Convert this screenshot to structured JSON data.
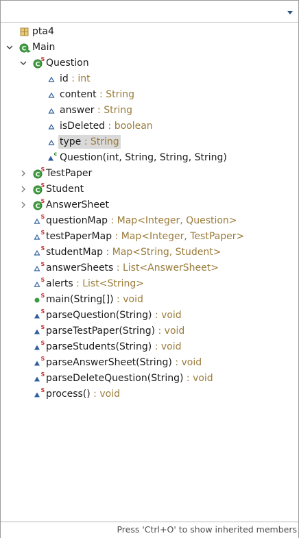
{
  "filter": {
    "value": "",
    "placeholder": ""
  },
  "status": "Press 'Ctrl+O' to show inherited members",
  "nodes": [
    {
      "level": 0,
      "twisty": "none",
      "icon": "package-icon",
      "name": "pta4",
      "type": ""
    },
    {
      "level": 0,
      "twisty": "expanded",
      "icon": "class-run-icon",
      "name": "Main",
      "type": ""
    },
    {
      "level": 1,
      "twisty": "expanded",
      "icon": "static-class-icon",
      "name": "Question",
      "type": ""
    },
    {
      "level": 2,
      "twisty": "none",
      "icon": "package-field-icon",
      "name": "id",
      "type": " : int"
    },
    {
      "level": 2,
      "twisty": "none",
      "icon": "package-field-icon",
      "name": "content",
      "type": " : String"
    },
    {
      "level": 2,
      "twisty": "none",
      "icon": "package-field-icon",
      "name": "answer",
      "type": " : String"
    },
    {
      "level": 2,
      "twisty": "none",
      "icon": "package-field-icon",
      "name": "isDeleted",
      "type": " : boolean"
    },
    {
      "level": 2,
      "twisty": "none",
      "icon": "package-field-icon",
      "name": "type",
      "type": " : String",
      "selected": true
    },
    {
      "level": 2,
      "twisty": "none",
      "icon": "constructor-icon",
      "name": "Question(int, String, String, String)",
      "type": ""
    },
    {
      "level": 1,
      "twisty": "collapsed",
      "icon": "static-class-icon",
      "name": "TestPaper",
      "type": ""
    },
    {
      "level": 1,
      "twisty": "collapsed",
      "icon": "static-class-icon",
      "name": "Student",
      "type": ""
    },
    {
      "level": 1,
      "twisty": "collapsed",
      "icon": "static-class-icon",
      "name": "AnswerSheet",
      "type": ""
    },
    {
      "level": 1,
      "twisty": "none",
      "icon": "static-field-icon",
      "name": "questionMap",
      "type": " : Map<Integer, Question>"
    },
    {
      "level": 1,
      "twisty": "none",
      "icon": "static-field-icon",
      "name": "testPaperMap",
      "type": " : Map<Integer, TestPaper>"
    },
    {
      "level": 1,
      "twisty": "none",
      "icon": "static-field-icon",
      "name": "studentMap",
      "type": " : Map<String, Student>"
    },
    {
      "level": 1,
      "twisty": "none",
      "icon": "static-field-icon",
      "name": "answerSheets",
      "type": " : List<AnswerSheet>"
    },
    {
      "level": 1,
      "twisty": "none",
      "icon": "static-field-icon",
      "name": "alerts",
      "type": " : List<String>"
    },
    {
      "level": 1,
      "twisty": "none",
      "icon": "public-static-method-icon",
      "name": "main(String[])",
      "type": " : void"
    },
    {
      "level": 1,
      "twisty": "none",
      "icon": "static-method-icon",
      "name": "parseQuestion(String)",
      "type": " : void"
    },
    {
      "level": 1,
      "twisty": "none",
      "icon": "static-method-icon",
      "name": "parseTestPaper(String)",
      "type": " : void"
    },
    {
      "level": 1,
      "twisty": "none",
      "icon": "static-method-icon",
      "name": "parseStudents(String)",
      "type": " : void"
    },
    {
      "level": 1,
      "twisty": "none",
      "icon": "static-method-icon",
      "name": "parseAnswerSheet(String)",
      "type": " : void"
    },
    {
      "level": 1,
      "twisty": "none",
      "icon": "static-method-icon",
      "name": "parseDeleteQuestion(String)",
      "type": " : void"
    },
    {
      "level": 1,
      "twisty": "none",
      "icon": "static-method-icon",
      "name": "process()",
      "type": " : void"
    }
  ],
  "colors": {
    "type_text": "#9a7b3a",
    "class_green": "#3a8a3a",
    "method_blue": "#2e5d9e",
    "public_green": "#3d9a3d",
    "static_red": "#c83232",
    "selection": "#d9d9d9"
  }
}
